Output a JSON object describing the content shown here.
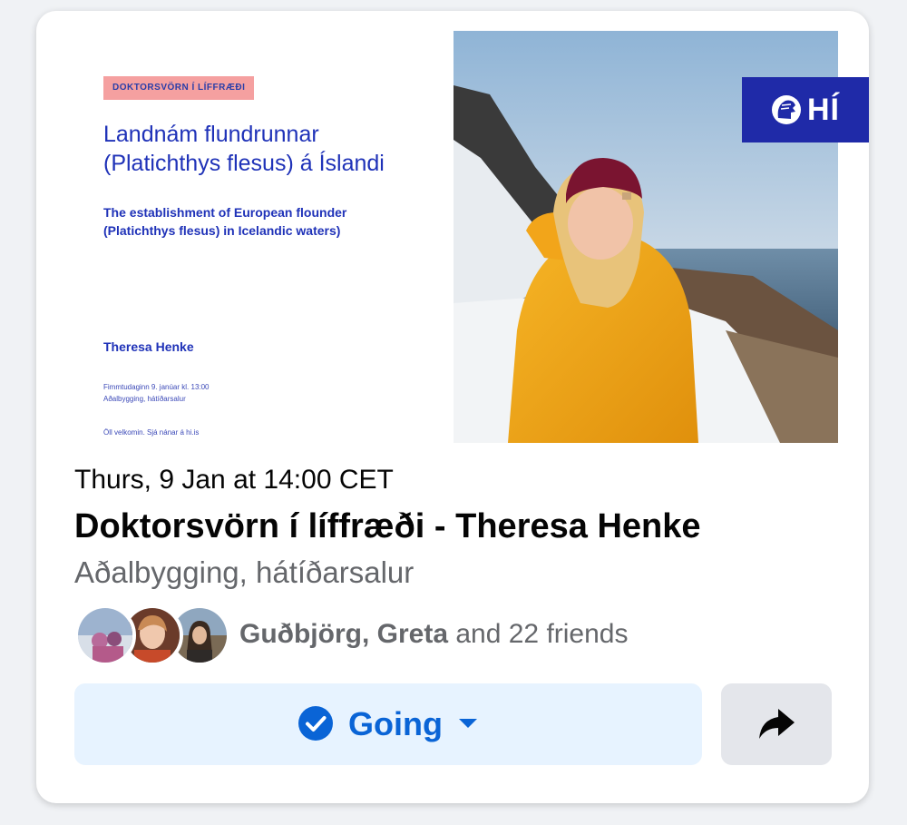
{
  "poster": {
    "tag": "DOKTORSVÖRN Í LÍFFRÆÐI",
    "title_line1": "Landnám flundrunnar",
    "title_line2": "(Platichthys flesus) á Íslandi",
    "subtitle_line1": "The establishment of European flounder",
    "subtitle_line2": "(Platichthys flesus) in Icelandic waters)",
    "name": "Theresa Henke",
    "details_line1": "Fimmtudaginn 9. janúar kl. 13:00",
    "details_line2": "Aðalbygging, hátíðarsalur",
    "welcome": "Öll velkomin. Sjá nánar á hi.is",
    "logo_text": "HÍ"
  },
  "event": {
    "date": "Thurs, 9 Jan at 14:00 CET",
    "title": "Doktorsvörn í líffræði - Theresa Henke",
    "location": "Aðalbygging, hátíðarsalur"
  },
  "friends": {
    "names": "Guðbjörg, Greta",
    "rest": " and 22 friends"
  },
  "actions": {
    "going_label": "Going",
    "going_icon": "check-circle-icon",
    "dropdown_icon": "caret-down-icon",
    "share_icon": "share-arrow-icon"
  },
  "colors": {
    "accent": "#0a64d6",
    "going_bg": "#e7f3ff",
    "share_bg": "#e4e6eb",
    "poster_blue": "#1f32b8",
    "logo_bg": "#1f2aa8",
    "tag_bg": "#f5a0a0",
    "jacket": "#f2a51a"
  }
}
